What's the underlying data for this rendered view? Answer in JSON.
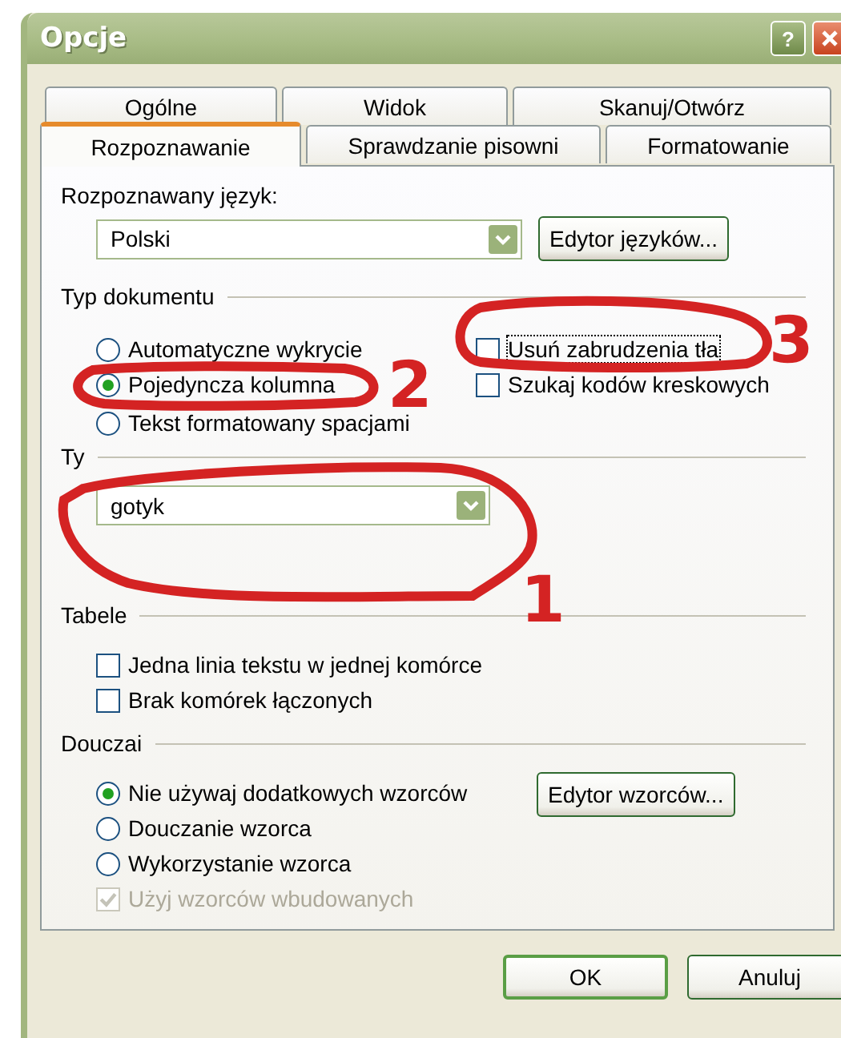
{
  "window": {
    "title": "Opcje",
    "help": "?"
  },
  "tab_rows": [
    {
      "tabs": [
        {
          "label": "Ogólne",
          "selected": false
        },
        {
          "label": "Widok",
          "selected": false
        },
        {
          "label": "Skanuj/Otwórz",
          "selected": false
        }
      ]
    },
    {
      "tabs": [
        {
          "label": "Rozpoznawanie",
          "selected": true
        },
        {
          "label": "Sprawdzanie pisowni",
          "selected": false
        },
        {
          "label": "Formatowanie",
          "selected": false
        }
      ]
    }
  ],
  "language": {
    "label": "Rozpoznawany język:",
    "value": "Polski",
    "button": "Edytor języków..."
  },
  "document_type": {
    "title": "Typ dokumentu",
    "radios": [
      {
        "label": "Automatyczne wykrycie",
        "selected": false
      },
      {
        "label": "Pojedyncza kolumna",
        "selected": true
      },
      {
        "label": "Tekst formatowany spacjami",
        "selected": false
      }
    ],
    "checkboxes": [
      {
        "label": "Usuń zabrudzenia tła",
        "checked": false,
        "focused": true
      },
      {
        "label": "Szukaj kodów kreskowych",
        "checked": false,
        "focused": false
      }
    ]
  },
  "font": {
    "title": "Ty",
    "value": "gotyk"
  },
  "tables": {
    "title": "Tabele",
    "checkboxes": [
      {
        "label": "Jedna linia tekstu w jednej komórce",
        "checked": false,
        "disabled": false
      },
      {
        "label": "Brak komórek łączonych",
        "checked": false,
        "disabled": false
      }
    ]
  },
  "training": {
    "title": "Douczai",
    "button": "Edytor wzorców...",
    "radios": [
      {
        "label": "Nie używaj dodatkowych wzorców",
        "selected": true
      },
      {
        "label": "Douczanie wzorca",
        "selected": false
      },
      {
        "label": "Wykorzystanie wzorca",
        "selected": false
      }
    ],
    "checkboxes": [
      {
        "label": "Użyj wzorców wbudowanych",
        "checked": true,
        "disabled": true
      }
    ]
  },
  "buttons": [
    "OK",
    "Anuluj"
  ],
  "annotations": [
    {
      "label": "1"
    },
    {
      "label": "2"
    },
    {
      "label": "3"
    }
  ]
}
